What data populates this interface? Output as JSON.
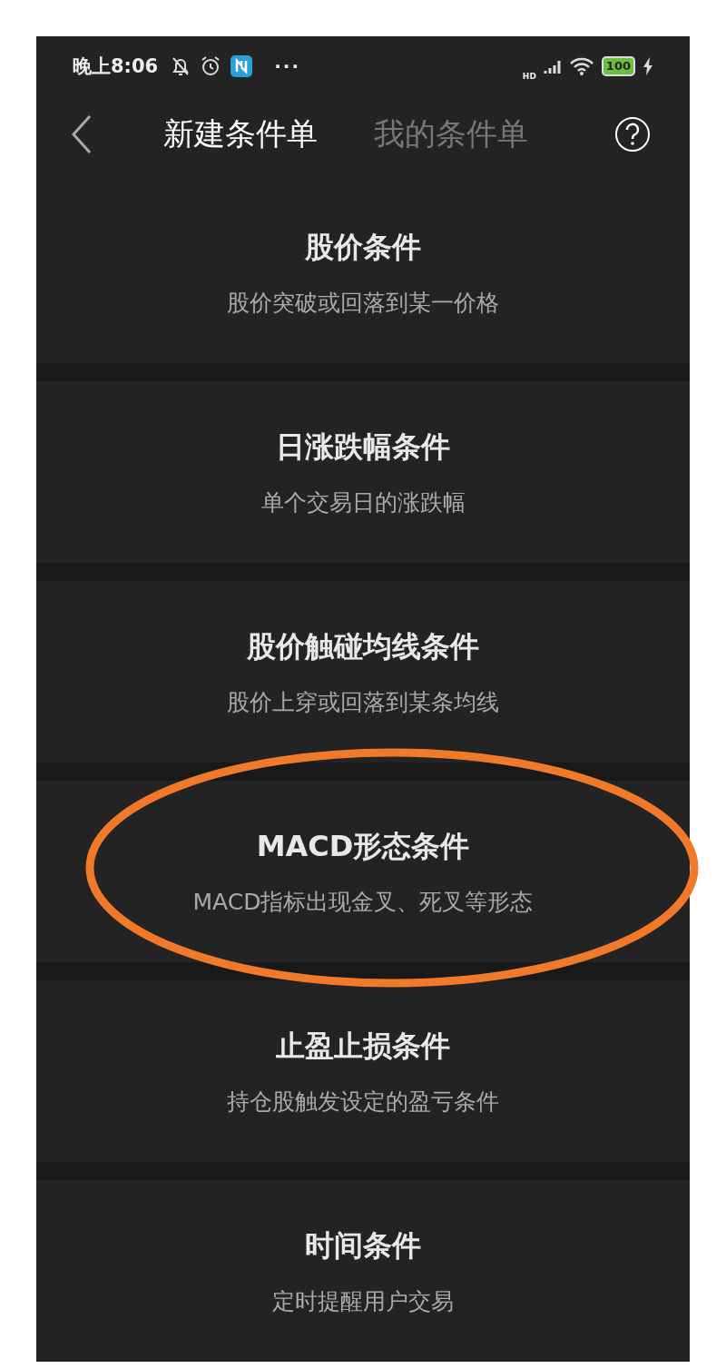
{
  "status_bar": {
    "time": "晚上8:06",
    "network": "HD",
    "battery": "100",
    "more": "···"
  },
  "tabs": [
    {
      "label": "新建条件单",
      "selected": true
    },
    {
      "label": "我的条件单",
      "selected": false
    }
  ],
  "items": [
    {
      "title": "股价条件",
      "subtitle": "股价突破或回落到某一价格",
      "circled": false
    },
    {
      "title": "日涨跌幅条件",
      "subtitle": "单个交易日的涨跌幅",
      "circled": false
    },
    {
      "title": "股价触碰均线条件",
      "subtitle": "股价上穿或回落到某条均线",
      "circled": false
    },
    {
      "title": "MACD形态条件",
      "subtitle": "MACD指标出现金叉、死叉等形态",
      "circled": true
    },
    {
      "title": "止盈止损条件",
      "subtitle": "持仓股触发设定的盈亏条件",
      "circled": false
    },
    {
      "title": "时间条件",
      "subtitle": "定时提醒用户交易",
      "circled": false
    }
  ]
}
